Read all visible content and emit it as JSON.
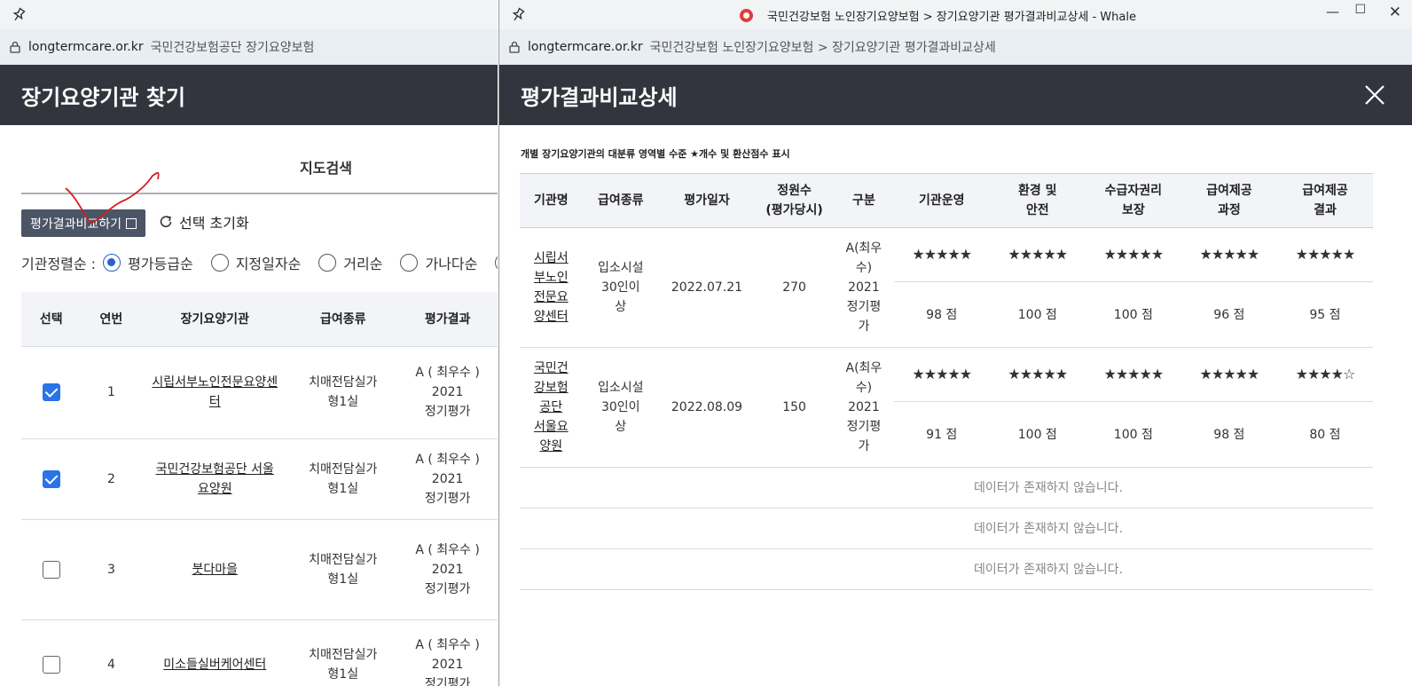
{
  "left": {
    "url_domain": "longtermcare.or.kr",
    "page_title": "국민건강보험공단 장기요양보험",
    "header": "장기요양기관 찾기",
    "tab_label": "지도검색",
    "compare_button": "평가결과비교하기",
    "reset_label": "선택 초기화",
    "sort_label": "기관정렬순 :",
    "sort_options": [
      "평가등급순",
      "지정일자순",
      "거리순",
      "가나다순"
    ],
    "columns": [
      "선택",
      "연번",
      "장기요양기관",
      "급여종류",
      "평가결과"
    ],
    "rows": [
      {
        "checked": true,
        "no": "1",
        "name": "시립서부노인전문요양센터",
        "type": "치매전담실가형1실",
        "result": "A ( 최우수 )",
        "year": "2021",
        "kind": "정기평가"
      },
      {
        "checked": true,
        "no": "2",
        "name": "국민건강보험공단 서울요양원",
        "type": "치매전담실가형1실",
        "result": "A ( 최우수 )",
        "year": "2021",
        "kind": "정기평가"
      },
      {
        "checked": false,
        "no": "3",
        "name": "붓다마을",
        "type": "치매전담실가형1실",
        "result": "A ( 최우수 )",
        "year": "2021",
        "kind": "정기평가"
      },
      {
        "checked": false,
        "no": "4",
        "name": "미소들실버케어센터",
        "type": "치매전담실가형1실",
        "result": "A ( 최우수 )",
        "year": "2021",
        "kind": "정기평가"
      }
    ]
  },
  "right": {
    "window_title": "국민건강보험 노인장기요양보험 > 장기요양기관 평가결과비교상세 - Whale",
    "url_domain": "longtermcare.or.kr",
    "page_title": "국민건강보험 노인장기요양보험 > 장기요양기관 평가결과비교상세",
    "header": "평가결과비교상세",
    "subtitle": "개별 장기요양기관의 대분류 영역별 수준 ★개수 및 환산점수 표시",
    "columns": [
      "기관명",
      "급여종류",
      "평가일자",
      "정원수\n(평가당시)",
      "구분",
      "기관운영",
      "환경 및\n안전",
      "수급자권리\n보장",
      "급여제공\n과정",
      "급여제공\n결과"
    ],
    "rows": [
      {
        "name": "시립서부노인전문요양센터",
        "type": "입소시설30인이상",
        "date": "2022.07.21",
        "capacity": "270",
        "grade": "A(최우수)\n2021\n정기평가",
        "stars": [
          5,
          5,
          5,
          5,
          5
        ],
        "scores": [
          "98 점",
          "100 점",
          "100 점",
          "96 점",
          "95 점"
        ]
      },
      {
        "name": "국민건강보험공단 서울요양원",
        "type": "입소시설30인이상",
        "date": "2022.08.09",
        "capacity": "150",
        "grade": "A(최우수)\n2021\n정기평가",
        "stars": [
          5,
          5,
          5,
          5,
          4
        ],
        "scores": [
          "91 점",
          "100 점",
          "100 점",
          "98 점",
          "80 점"
        ]
      }
    ],
    "empty_message": "데이터가 존재하지 않습니다.",
    "empty_rows": 3
  },
  "colors": {
    "header_bg": "#32353d",
    "star": "#e8606a",
    "accent": "#2a73e8"
  }
}
